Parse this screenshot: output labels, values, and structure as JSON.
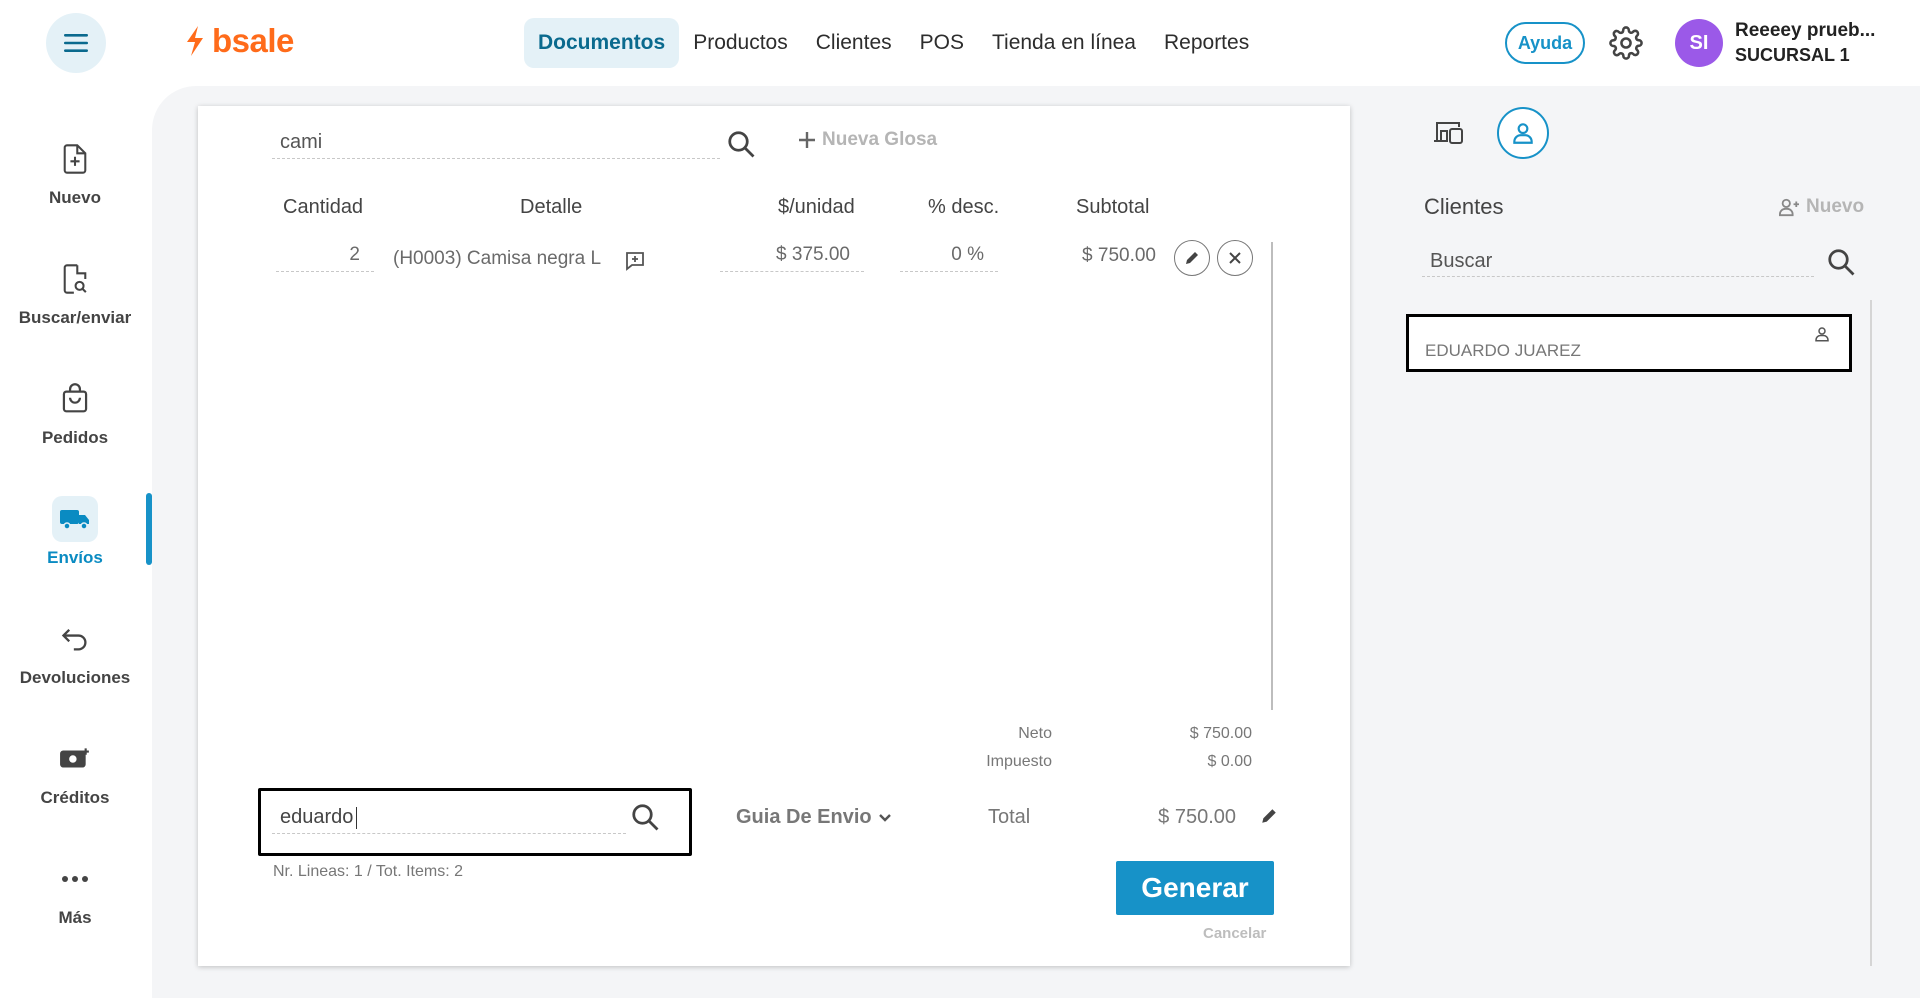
{
  "header": {
    "logo_text": "bsale",
    "nav": [
      {
        "label": "Documentos",
        "active": true
      },
      {
        "label": "Productos",
        "active": false
      },
      {
        "label": "Clientes",
        "active": false
      },
      {
        "label": "POS",
        "active": false
      },
      {
        "label": "Tienda en línea",
        "active": false
      },
      {
        "label": "Reportes",
        "active": false
      }
    ],
    "help_label": "Ayuda",
    "avatar_initials": "SI",
    "user_name": "Reeeey prueb...",
    "branch": "SUCURSAL 1",
    "accent_color": "#1792c8",
    "brand_color": "#ff6b1a"
  },
  "sidebar": {
    "items": [
      {
        "label": "Nuevo",
        "icon": "file-plus-icon"
      },
      {
        "label": "Buscar/enviar",
        "icon": "file-search-icon"
      },
      {
        "label": "Pedidos",
        "icon": "shopping-bag-icon"
      },
      {
        "label": "Envíos",
        "icon": "truck-icon",
        "active": true
      },
      {
        "label": "Devoluciones",
        "icon": "return-arrow-icon"
      },
      {
        "label": "Créditos",
        "icon": "money-plus-icon"
      },
      {
        "label": "Más",
        "icon": "more-dots-icon"
      }
    ]
  },
  "document": {
    "product_search_value": "cami",
    "new_gloss_label": "Nueva Glosa",
    "columns": [
      "Cantidad",
      "Detalle",
      "$/unidad",
      "% desc.",
      "Subtotal"
    ],
    "rows": [
      {
        "quantity": "2",
        "detail": "(H0003) Camisa negra L",
        "unit_price": "$ 375.00",
        "discount": "0 %",
        "subtotal": "$ 750.00"
      }
    ],
    "totals": {
      "neto_label": "Neto",
      "neto_value": "$ 750.00",
      "impuesto_label": "Impuesto",
      "impuesto_value": "$ 0.00",
      "total_label": "Total",
      "total_value": "$ 750.00"
    },
    "client_search_value": "eduardo",
    "doc_type": "Guia De Envio",
    "lines_info": "Nr. Lineas: 1 / Tot. Items: 2",
    "generate_label": "Generar",
    "cancel_label": "Cancelar"
  },
  "clients_panel": {
    "title": "Clientes",
    "new_label": "Nuevo",
    "search_placeholder": "Buscar",
    "results": [
      {
        "name": "EDUARDO JUAREZ"
      }
    ]
  }
}
